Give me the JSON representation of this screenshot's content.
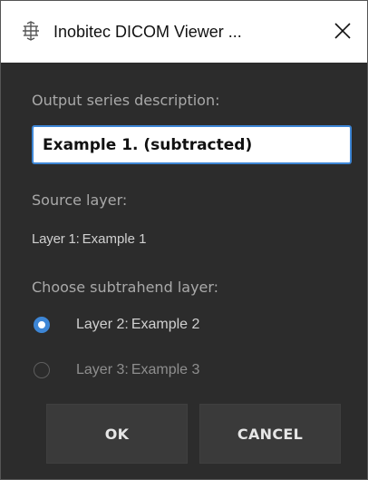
{
  "window": {
    "title": "Inobitec DICOM Viewer ...",
    "app_icon": "inobitec-app-icon",
    "close_icon": "close-icon"
  },
  "form": {
    "output_label": "Output series description:",
    "output_value": "Example 1. (subtracted)",
    "source_label": "Source layer:",
    "source_layer_name": "Layer 1:",
    "source_layer_series": "Example 1",
    "choose_label": "Choose subtrahend layer:",
    "options": [
      {
        "layer": "Layer 2:",
        "series": "Example 2",
        "selected": true
      },
      {
        "layer": "Layer 3:",
        "series": "Example 3",
        "selected": false
      }
    ]
  },
  "buttons": {
    "ok": "OK",
    "cancel": "CANCEL"
  },
  "colors": {
    "background": "#2c2c2c",
    "accent": "#3d86d6",
    "button": "#3a3a3a"
  }
}
